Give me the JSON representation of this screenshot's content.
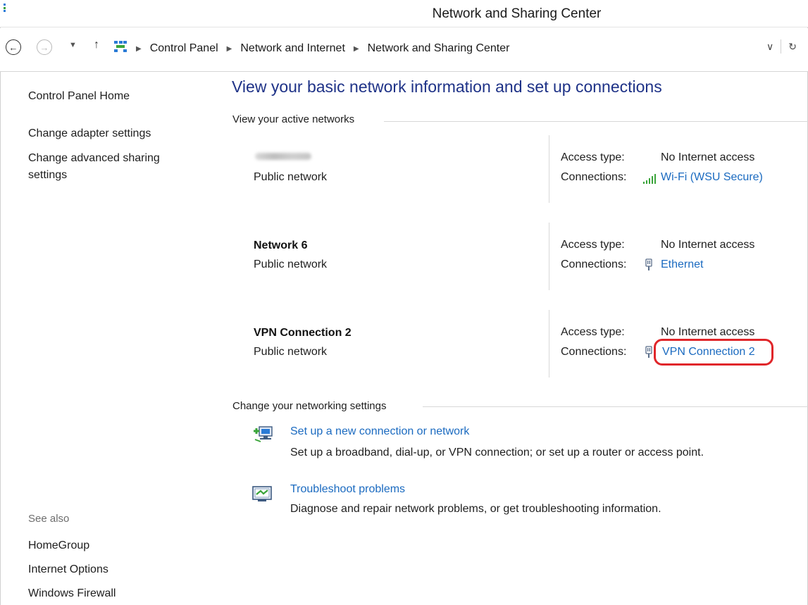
{
  "window": {
    "title": "Network and Sharing Center"
  },
  "address": {
    "crumbs": [
      "Control Panel",
      "Network and Internet",
      "Network and Sharing Center"
    ]
  },
  "sidebar": {
    "home": "Control Panel Home",
    "links": [
      "Change adapter settings",
      "Change advanced sharing settings"
    ],
    "see_also_label": "See also",
    "see_also": [
      "HomeGroup",
      "Internet Options",
      "Windows Firewall"
    ]
  },
  "main": {
    "heading": "View your basic network information and set up connections",
    "active_networks_label": "View your active networks",
    "networks": [
      {
        "name": "",
        "category": "Public network",
        "access_label": "Access type:",
        "access": "No Internet access",
        "conn_label": "Connections:",
        "conn": "Wi-Fi (WSU Secure)",
        "conn_icon": "wifi-signal-icon"
      },
      {
        "name": "Network  6",
        "category": "Public network",
        "access_label": "Access type:",
        "access": "No Internet access",
        "conn_label": "Connections:",
        "conn": "Ethernet",
        "conn_icon": "ethernet-plug-icon"
      },
      {
        "name": "VPN Connection 2",
        "category": "Public network",
        "access_label": "Access type:",
        "access": "No Internet access",
        "conn_label": "Connections:",
        "conn": "VPN Connection 2",
        "conn_icon": "vpn-plug-icon"
      }
    ],
    "change_settings_label": "Change your networking settings",
    "tasks": [
      {
        "link": "Set up a new connection or network",
        "desc": "Set up a broadband, dial-up, or VPN connection; or set up a router or access point.",
        "icon": "new-connection-icon"
      },
      {
        "link": "Troubleshoot problems",
        "desc": "Diagnose and repair network problems, or get troubleshooting information.",
        "icon": "troubleshoot-icon"
      }
    ]
  },
  "colors": {
    "link": "#1a6ac0",
    "heading": "#1e3287",
    "highlight": "#e0262a"
  }
}
